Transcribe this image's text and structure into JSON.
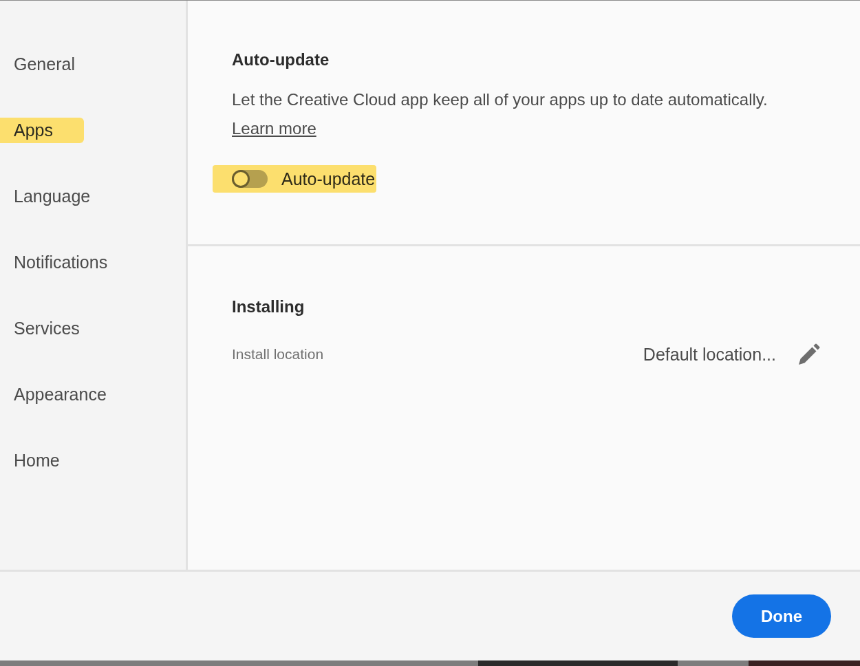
{
  "sidebar": {
    "items": [
      {
        "label": "General",
        "highlighted": false
      },
      {
        "label": "Apps",
        "highlighted": true
      },
      {
        "label": "Language",
        "highlighted": false
      },
      {
        "label": "Notifications",
        "highlighted": false
      },
      {
        "label": "Services",
        "highlighted": false
      },
      {
        "label": "Appearance",
        "highlighted": false
      },
      {
        "label": "Home",
        "highlighted": false
      }
    ]
  },
  "auto_update": {
    "heading": "Auto-update",
    "description": "Let the Creative Cloud app keep all of your apps up to date automatically.",
    "link": "Learn more",
    "toggle": {
      "label": "Auto-update",
      "on": false,
      "highlighted": true
    }
  },
  "installing": {
    "heading": "Installing",
    "install_location": {
      "label": "Install location",
      "value": "Default location..."
    }
  },
  "footer": {
    "buttons": [
      "Done"
    ]
  }
}
